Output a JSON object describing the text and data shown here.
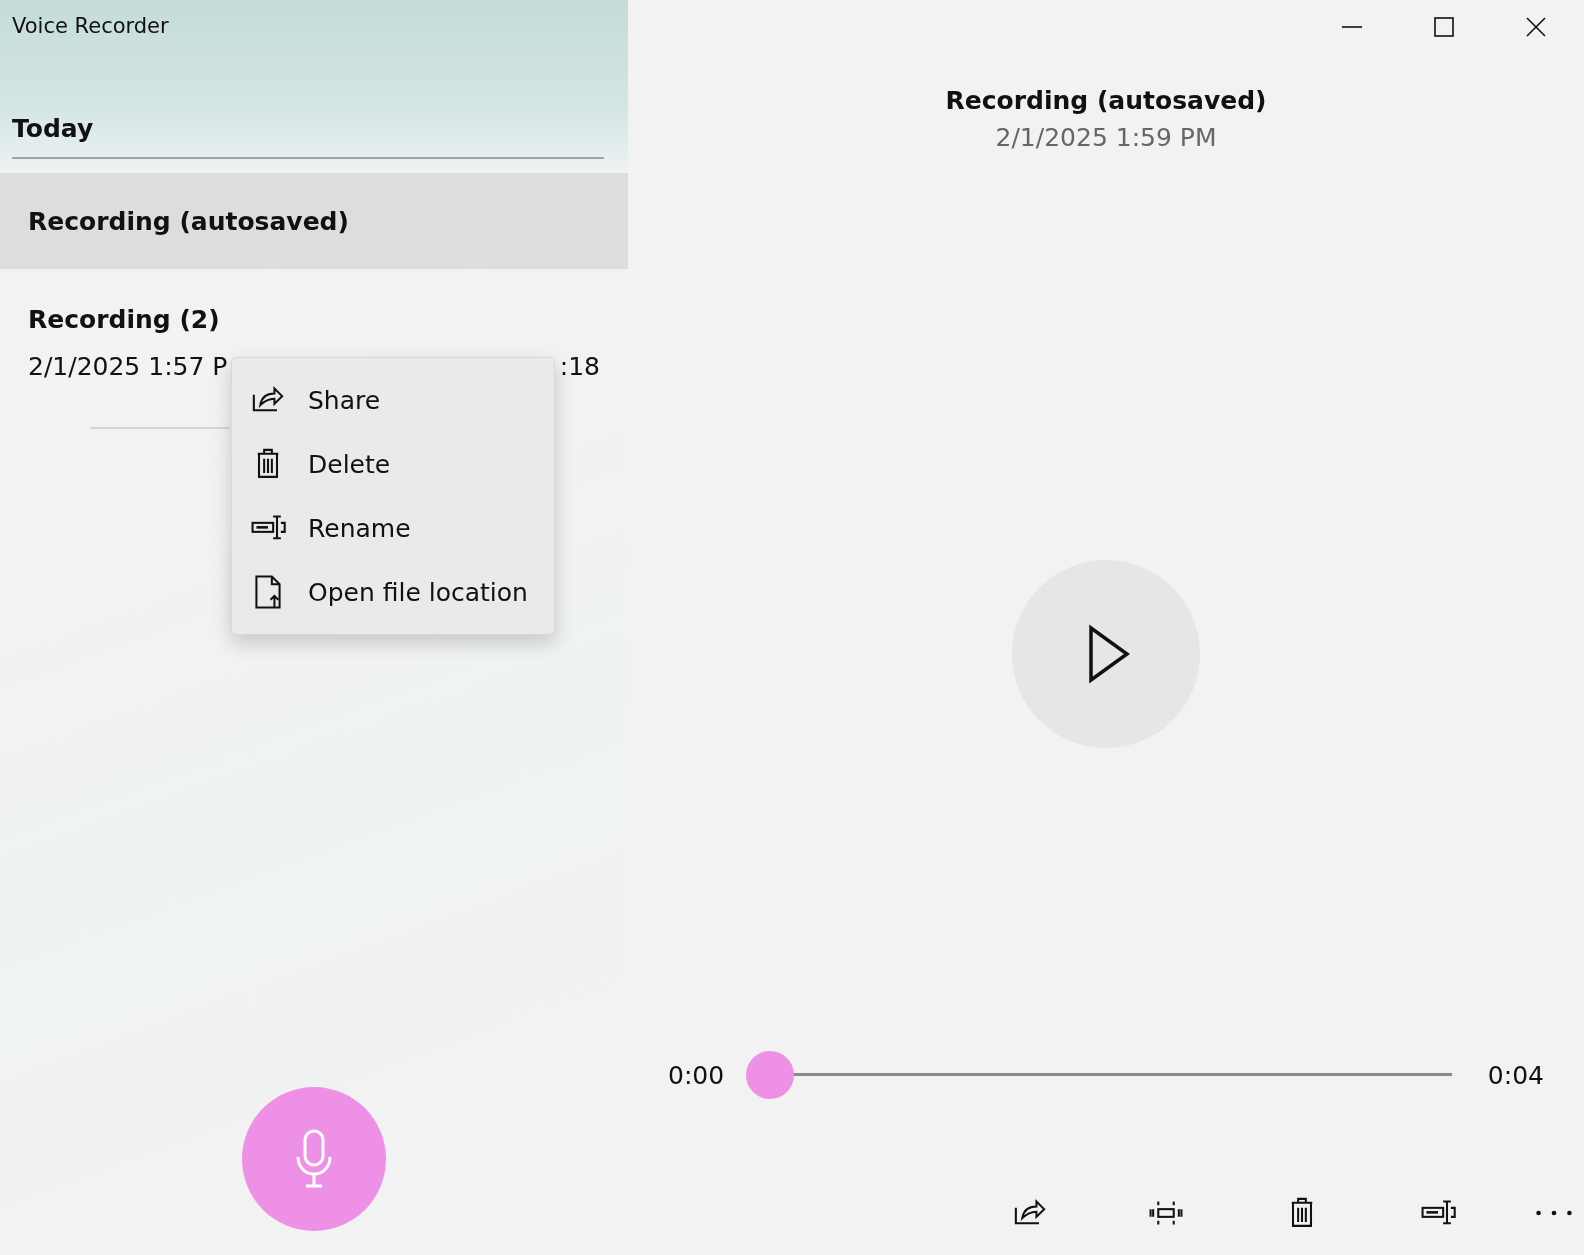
{
  "window": {
    "title": "Voice Recorder"
  },
  "sidebar": {
    "group": "Today",
    "items": [
      {
        "name": "Recording (autosaved)",
        "selected": true
      },
      {
        "name": "Recording (2)",
        "date": "2/1/2025 1:57 P",
        "duration": ":18",
        "selected": false
      }
    ]
  },
  "context_menu": {
    "items": [
      {
        "kind": "share",
        "label": "Share"
      },
      {
        "kind": "delete",
        "label": "Delete"
      },
      {
        "kind": "rename",
        "label": "Rename"
      },
      {
        "kind": "folder",
        "label": "Open file location"
      }
    ]
  },
  "player": {
    "title": "Recording (autosaved)",
    "date": "2/1/2025 1:59 PM",
    "position": "0:00",
    "length": "0:04",
    "level": 0
  },
  "toolbar": [
    {
      "kind": "share"
    },
    {
      "kind": "trim"
    },
    {
      "kind": "delete"
    },
    {
      "kind": "rename"
    },
    {
      "kind": "more"
    }
  ]
}
